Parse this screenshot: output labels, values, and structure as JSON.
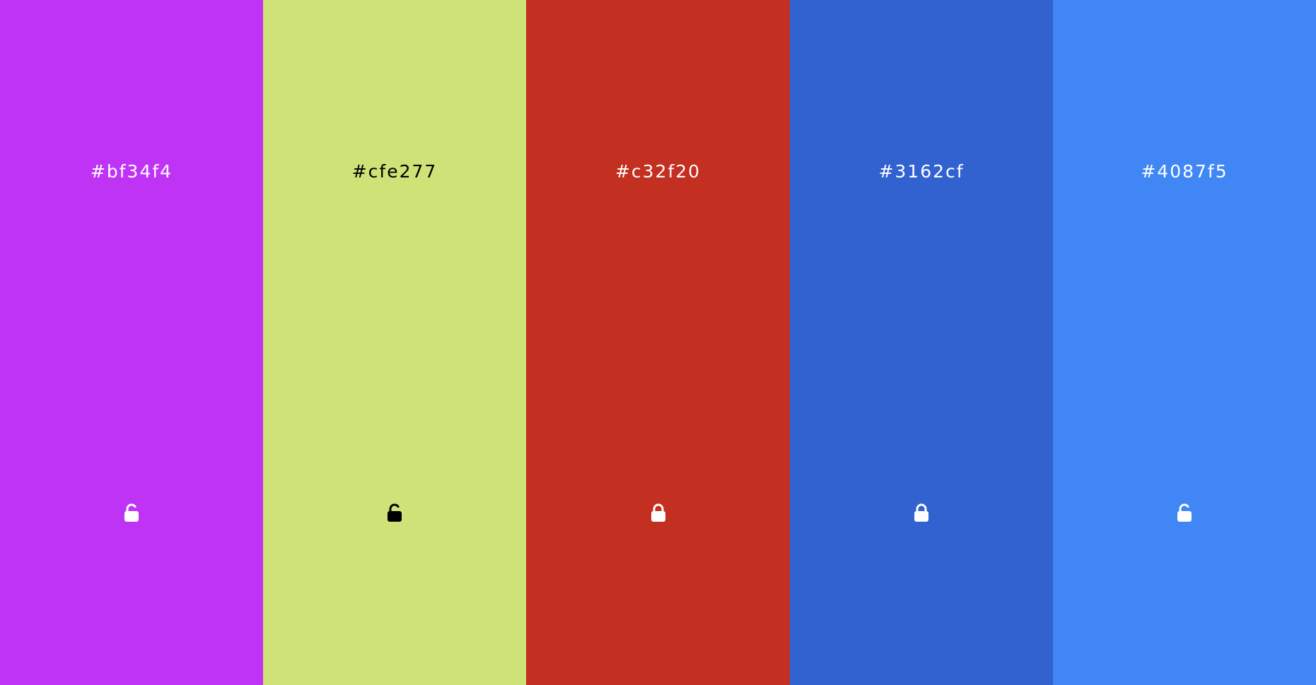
{
  "swatches": [
    {
      "hex": "#bf34f4",
      "background": "#bf34f4",
      "text_color": "#ffffff",
      "locked": false,
      "lock_icon": "lock-open-icon"
    },
    {
      "hex": "#cfe277",
      "background": "#cfe277",
      "text_color": "#000000",
      "locked": false,
      "lock_icon": "lock-open-icon"
    },
    {
      "hex": "#c32f20",
      "background": "#c32f20",
      "text_color": "#ffffff",
      "locked": true,
      "lock_icon": "lock-closed-icon"
    },
    {
      "hex": "#3162cf",
      "background": "#3162cf",
      "text_color": "#ffffff",
      "locked": true,
      "lock_icon": "lock-closed-icon"
    },
    {
      "hex": "#4087f5",
      "background": "#4087f5",
      "text_color": "#ffffff",
      "locked": false,
      "lock_icon": "lock-open-icon"
    }
  ]
}
